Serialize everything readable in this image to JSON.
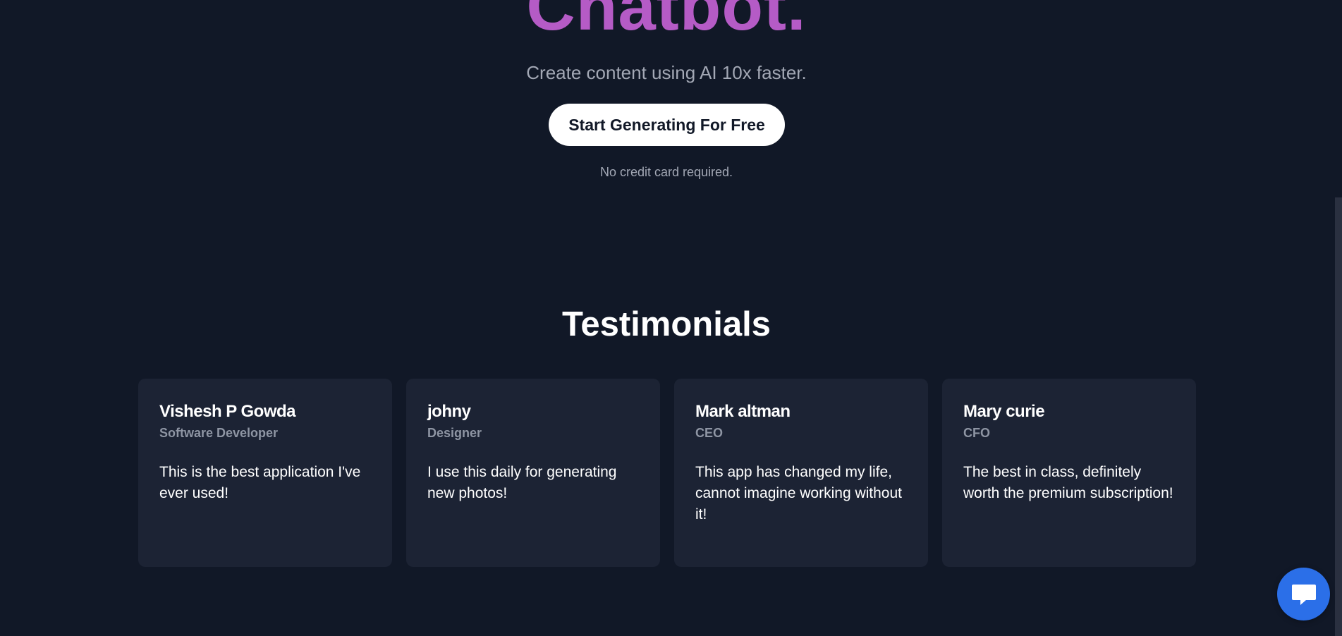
{
  "hero": {
    "title": "Chatbot.",
    "subtitle": "Create content using AI 10x faster.",
    "cta_label": "Start Generating For Free",
    "cta_note": "No credit card required."
  },
  "testimonials": {
    "title": "Testimonials",
    "items": [
      {
        "name": "Vishesh P Gowda",
        "role": "Software Developer",
        "quote": "This is the best application I've ever used!"
      },
      {
        "name": "johny",
        "role": "Designer",
        "quote": "I use this daily for generating new photos!"
      },
      {
        "name": "Mark altman",
        "role": "CEO",
        "quote": "This app has changed my life, cannot imagine working without it!"
      },
      {
        "name": "Mary curie",
        "role": "CFO",
        "quote": "The best in class, definitely worth the premium subscription!"
      }
    ]
  },
  "chat_widget": {
    "icon": "chat-bubble-icon",
    "color": "#2b6fe8"
  },
  "colors": {
    "background": "#111827",
    "card": "#1c2334",
    "title_accent": "#b55bc6",
    "muted_text": "#a3a8b5"
  }
}
